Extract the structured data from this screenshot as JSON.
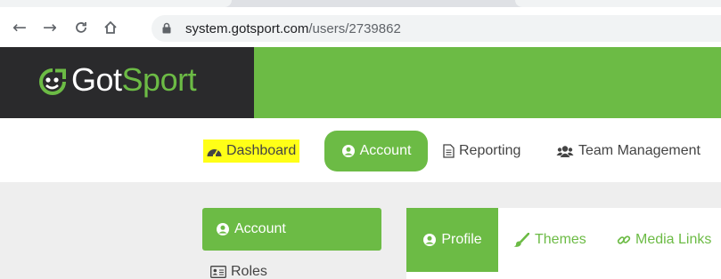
{
  "browser": {
    "url_host": "system.gotsport.com",
    "url_path": "/users/2739862",
    "back_icon": "arrow-left-icon",
    "forward_icon": "arrow-right-icon",
    "reload_icon": "reload-icon",
    "home_icon": "home-icon",
    "lock_icon": "lock-icon"
  },
  "header": {
    "logo_got": "Got",
    "logo_sport": "Sport",
    "brand_color": "#6cbb45",
    "logo_bg": "#2a2a2c"
  },
  "topnav": {
    "items": [
      {
        "label": "Dashboard",
        "icon": "tachometer-icon",
        "highlight": "#ffff17"
      },
      {
        "label": "Account",
        "icon": "user-circle-icon",
        "active": true
      },
      {
        "label": "Reporting",
        "icon": "file-text-icon"
      },
      {
        "label": "Team Management",
        "icon": "users-icon"
      }
    ]
  },
  "sidebar": {
    "items": [
      {
        "label": "Account",
        "icon": "user-circle-icon",
        "active": true
      },
      {
        "label": "Roles",
        "icon": "id-card-icon"
      }
    ]
  },
  "tabs": {
    "items": [
      {
        "label": "Profile",
        "icon": "user-circle-icon",
        "active": true
      },
      {
        "label": "Themes",
        "icon": "paint-brush-icon"
      },
      {
        "label": "Media Links",
        "icon": "link-icon"
      }
    ]
  }
}
